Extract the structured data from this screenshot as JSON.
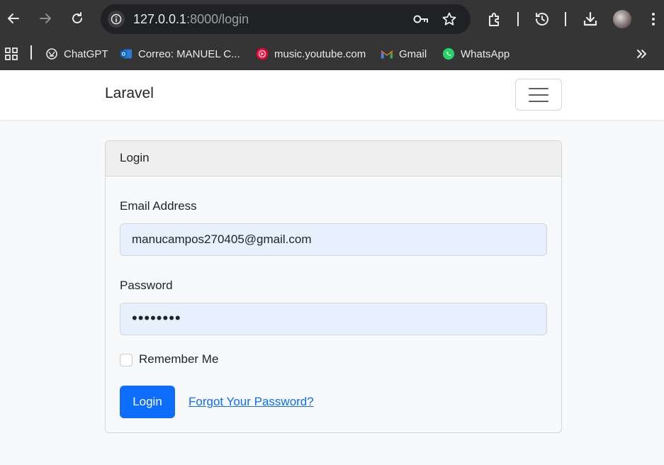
{
  "browser": {
    "url_host": "127.0.0.1",
    "url_rest": ":8000/login",
    "toolbar_icons": [
      "back-arrow-icon",
      "forward-arrow-icon",
      "reload-icon",
      "site-info-icon",
      "password-key-icon",
      "bookmark-star-icon",
      "extensions-icon",
      "history-icon",
      "download-icon",
      "profile-avatar",
      "menu-icon"
    ]
  },
  "bookmarks": [
    {
      "label": "ChatGPT",
      "icon": "chatgpt-icon"
    },
    {
      "label": "Correo: MANUEL C...",
      "icon": "outlook-icon"
    },
    {
      "label": "music.youtube.com",
      "icon": "youtube-music-icon"
    },
    {
      "label": "Gmail",
      "icon": "gmail-icon"
    },
    {
      "label": "WhatsApp",
      "icon": "whatsapp-icon"
    }
  ],
  "app": {
    "brand": "Laravel"
  },
  "login_card": {
    "header": "Login",
    "email_label": "Email Address",
    "email_value": "manucampos270405@gmail.com",
    "password_label": "Password",
    "password_masked": "••••••••",
    "remember_label": "Remember Me",
    "remember_checked": false,
    "submit_label": "Login",
    "forgot_label": "Forgot Your Password?"
  },
  "colors": {
    "primary": "#0d6efd",
    "autofill_bg": "#e8f0fe",
    "browser_chrome": "#353535"
  }
}
